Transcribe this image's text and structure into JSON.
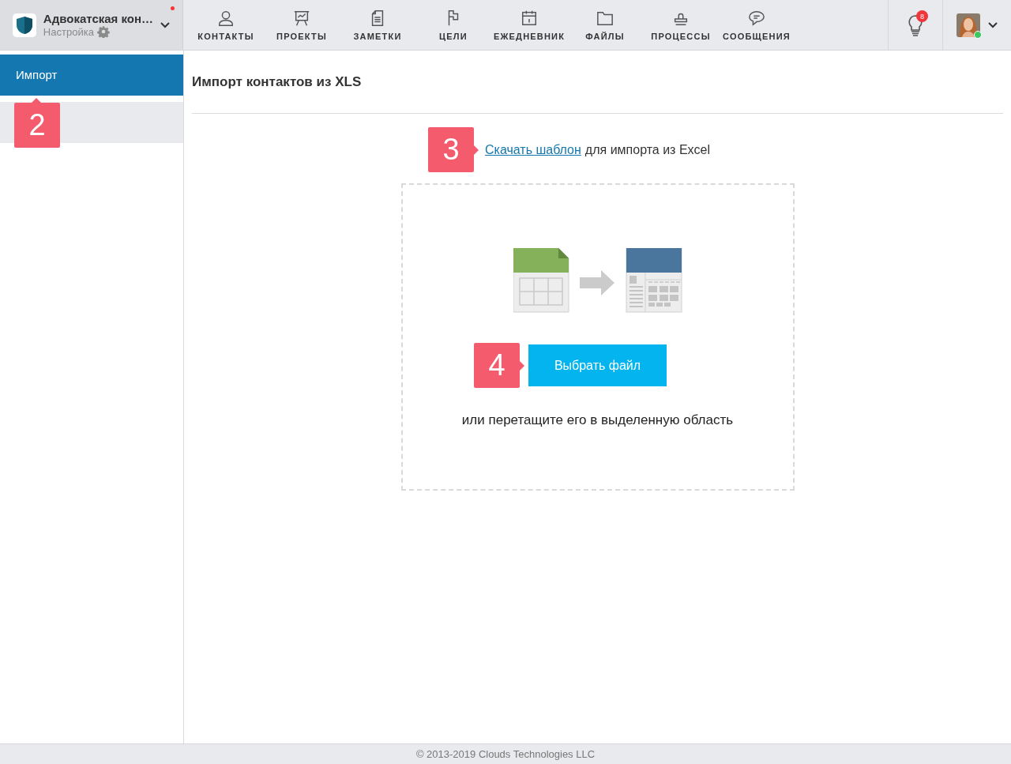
{
  "workspace": {
    "name": "Адвокатская кон…",
    "subtitle": "Настройка",
    "has_alert": true
  },
  "nav": [
    {
      "label": "КОНТАКТЫ",
      "kind": "user"
    },
    {
      "label": "ПРОЕКТЫ",
      "kind": "board"
    },
    {
      "label": "ЗАМЕТКИ",
      "kind": "note"
    },
    {
      "label": "ЦЕЛИ",
      "kind": "flag"
    },
    {
      "label": "ЕЖЕДНЕВНИК",
      "kind": "calendar"
    },
    {
      "label": "ФАЙЛЫ",
      "kind": "folder"
    },
    {
      "label": "ПРОЦЕССЫ",
      "kind": "stamp"
    },
    {
      "label": "СООБЩЕНИЯ",
      "kind": "chat"
    }
  ],
  "tips": {
    "badge": "8"
  },
  "user": {
    "online": true
  },
  "sidebar": {
    "items": [
      {
        "label": "Импорт",
        "selected": true
      }
    ]
  },
  "page": {
    "title": "Импорт контактов из XLS",
    "download_link": "Скачать шаблон",
    "download_text": "для импорта из Excel",
    "choose_button": "Выбрать файл",
    "drop_hint": "или перетащите его в выделенную область"
  },
  "callouts": {
    "sidebar": "2",
    "download": "3",
    "choose": "4"
  },
  "footer": "© 2013-2019 Clouds Technologies LLC"
}
